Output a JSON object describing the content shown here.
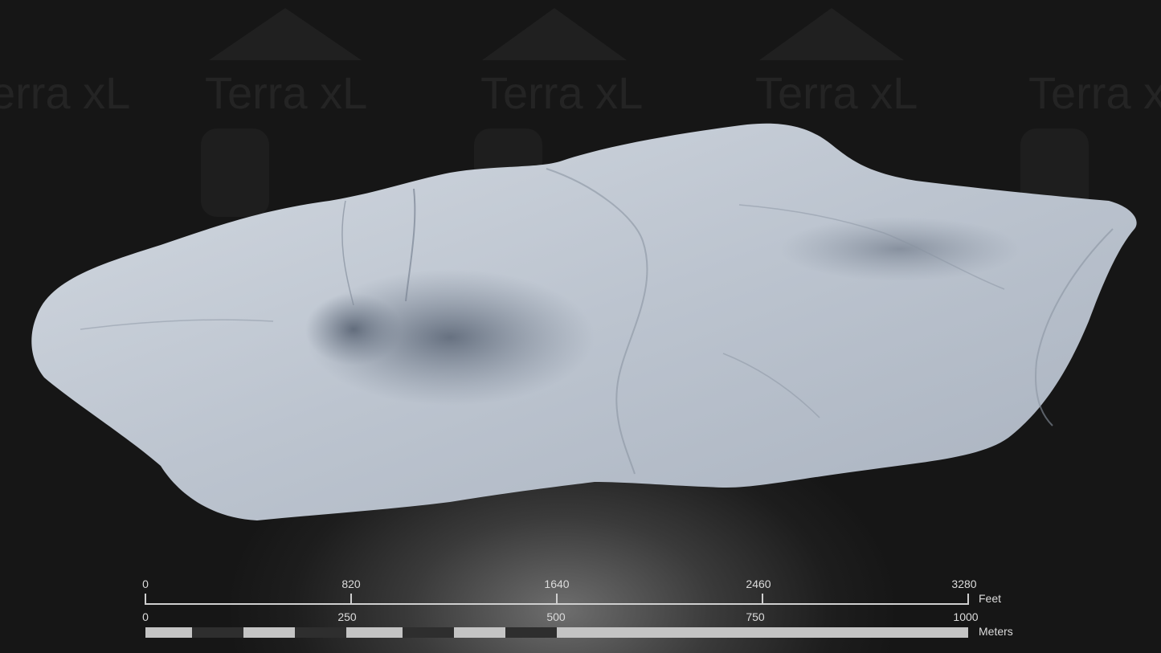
{
  "watermark": {
    "text": "Terra xL"
  },
  "terrain": {
    "description_icon": "terrain-model",
    "fill": "#b9c1cd"
  },
  "scale_bar": {
    "feet": {
      "ticks": [
        "0",
        "820",
        "1640",
        "2460",
        "3280"
      ],
      "unit": "Feet"
    },
    "meters": {
      "ticks": [
        "0",
        "250",
        "500",
        "750",
        "1000"
      ],
      "unit": "Meters"
    },
    "colors": {
      "light": "#c4c4c4",
      "dark": "#2e2e2e",
      "line": "#cfcfcf"
    }
  }
}
